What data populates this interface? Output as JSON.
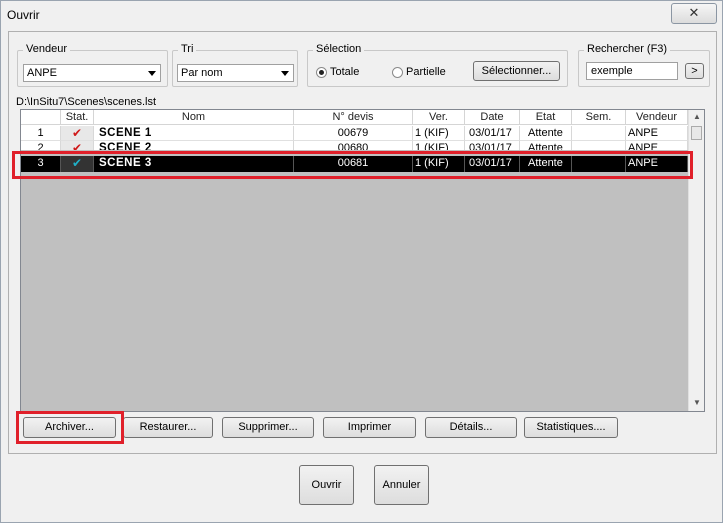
{
  "window": {
    "title": "Ouvrir",
    "close_label": "✕"
  },
  "filters": {
    "vendeur": {
      "label": "Vendeur",
      "value": "ANPE"
    },
    "tri": {
      "label": "Tri",
      "value": "Par nom"
    },
    "selection": {
      "label": "Sélection",
      "options": [
        {
          "label": "Totale",
          "selected": true
        },
        {
          "label": "Partielle",
          "selected": false
        }
      ],
      "button_label": "Sélectionner..."
    },
    "search": {
      "label": "Rechercher (F3)",
      "value": "exemple",
      "button_label": ">"
    }
  },
  "file_path": "D:\\InSitu7\\Scenes\\scenes.lst",
  "table": {
    "columns": [
      "",
      "Stat.",
      "Nom",
      "N° devis",
      "Ver.",
      "Date",
      "Etat",
      "Sem.",
      "Vendeur"
    ],
    "rows": [
      {
        "num": "1",
        "stat_icon": "red-check-icon",
        "nom": "SCENE 1",
        "devis": "00679",
        "ver": "1 (KIF)",
        "date": "03/01/17",
        "etat": "Attente",
        "sem": "",
        "vendeur": "ANPE"
      },
      {
        "num": "2",
        "stat_icon": "red-check-icon",
        "nom": "SCENE 2",
        "devis": "00680",
        "ver": "1 (KIF)",
        "date": "03/01/17",
        "etat": "Attente",
        "sem": "",
        "vendeur": "ANPE"
      },
      {
        "num": "3",
        "stat_icon": "cyan-check-icon",
        "nom": "SCENE 3",
        "devis": "00681",
        "ver": "1 (KIF)",
        "date": "03/01/17",
        "etat": "Attente",
        "sem": "",
        "vendeur": "ANPE",
        "selected": true
      }
    ]
  },
  "actions": [
    "Archiver...",
    "Restaurer...",
    "Supprimer...",
    "Imprimer",
    "Détails...",
    "Statistiques...."
  ],
  "footer": {
    "open_label": "Ouvrir",
    "cancel_label": "Annuler"
  },
  "colors": {
    "highlight_red": "#e0202a",
    "selected_row": "#000000",
    "check_red": "#d01818",
    "check_cyan": "#20b0c8"
  }
}
